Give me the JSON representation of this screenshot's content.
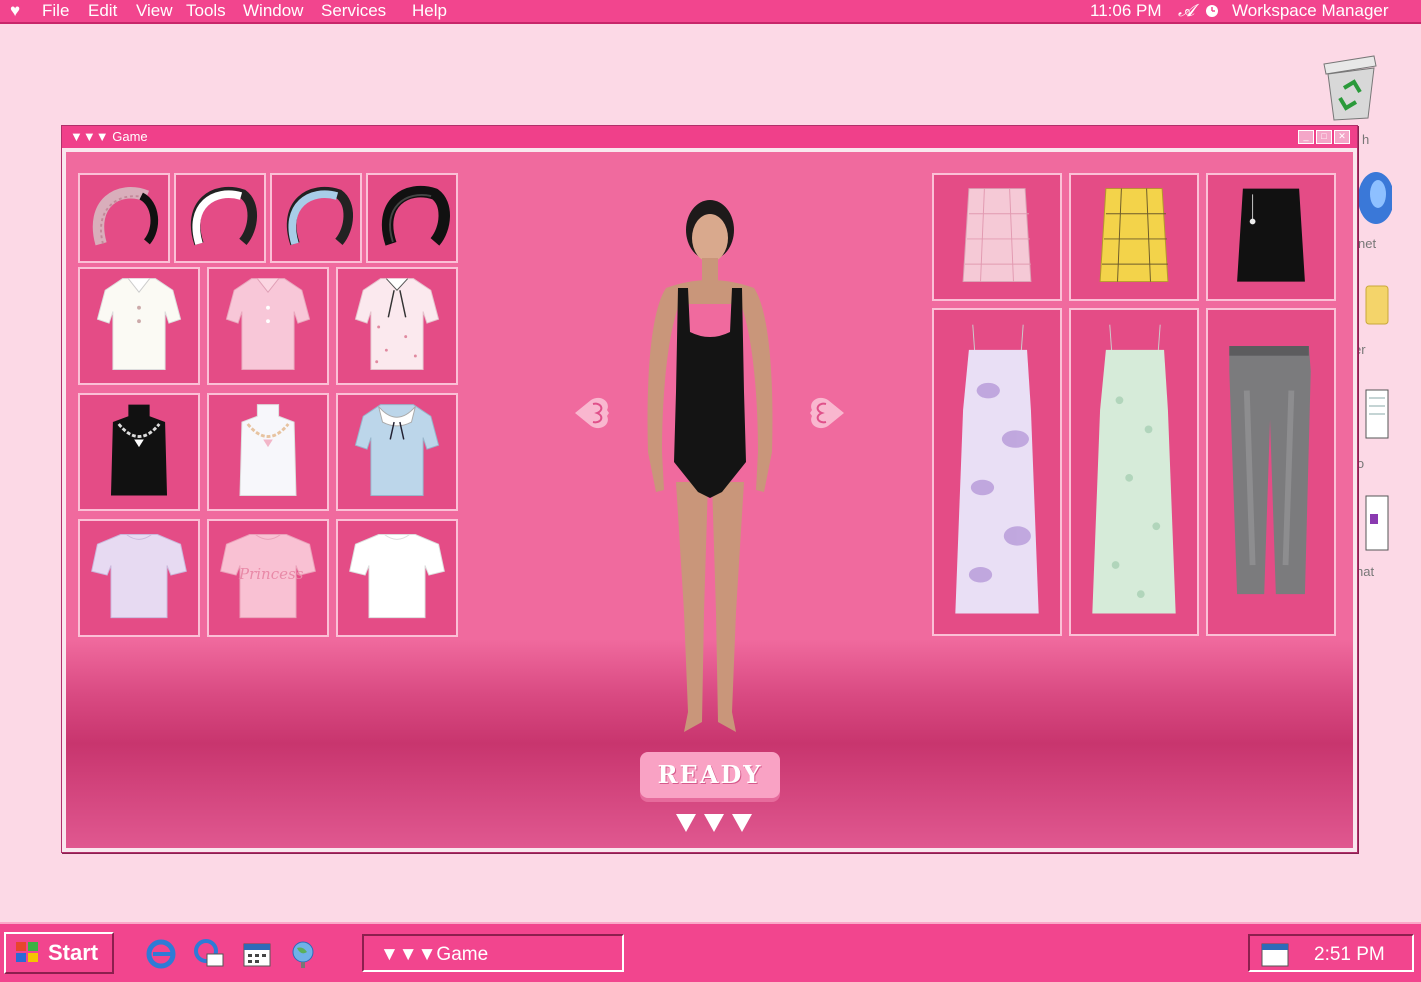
{
  "menubar": {
    "items": [
      "File",
      "Edit",
      "View",
      "Tools",
      "Window",
      "Services",
      "Help"
    ],
    "clock": "11:06 PM",
    "workspace": "Workspace Manager",
    "icons": [
      "heart-icon",
      "script-a-icon",
      "clock-icon"
    ]
  },
  "desktop": {
    "icons": [
      {
        "name": "recycle-bin-icon",
        "label": "h"
      },
      {
        "name": "internet-icon",
        "label": "net"
      },
      {
        "name": "folder-icon",
        "label": "er"
      },
      {
        "name": "notepad-icon",
        "label": "io"
      },
      {
        "name": "chat-icon",
        "label": "hat"
      }
    ]
  },
  "window": {
    "title": "Game",
    "title_prefix": "▼▼▼",
    "buttons": [
      "minimize",
      "maximize",
      "close"
    ]
  },
  "game": {
    "left_items": {
      "headbands": [
        "plaid-headband",
        "white-headband",
        "blue-headband",
        "black-headband"
      ],
      "tops_row1": [
        "white-puff-sleeve-blouse",
        "pink-puff-sleeve-blouse",
        "floral-bow-blouse"
      ],
      "tops_row2": [
        "black-chain-tank",
        "white-chain-tank",
        "blue-collar-blouse"
      ],
      "tops_row3": [
        "lavender-tee",
        "pink-princess-tee",
        "white-tee"
      ],
      "tee_text": "Princess"
    },
    "right_items": {
      "skirts": [
        "pink-plaid-skirt",
        "yellow-plaid-skirt",
        "black-skirt"
      ],
      "long": [
        "lavender-tie-dye-dress",
        "mint-floral-dress",
        "grey-jeans"
      ]
    },
    "ready_label": "READY",
    "footer_glyphs": "▼▼▼",
    "colors": {
      "accent": "#f2458e",
      "panel": "#e44c86",
      "bg": "#f06a9e"
    }
  },
  "taskbar": {
    "start_label": "Start",
    "quick_launch": [
      "ie-icon",
      "outlook-icon",
      "calendar-icon",
      "globe-icon"
    ],
    "task_title": "Game",
    "task_prefix": "▼▼▼",
    "tray_time": "2:51 PM"
  }
}
